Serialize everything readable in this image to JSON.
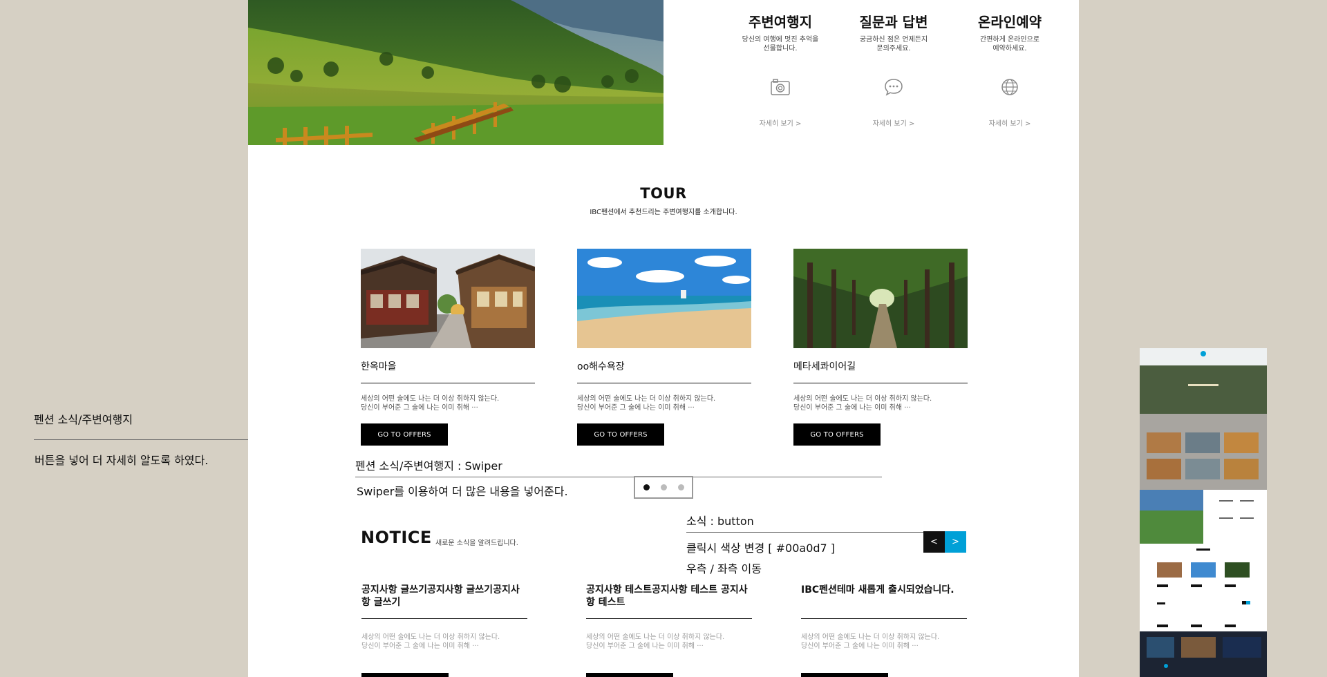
{
  "services": [
    {
      "title": "주변여행지",
      "desc_line1": "당신의 여행에 멋진 추억을",
      "desc_line2": "선물합니다.",
      "icon": "camera-icon",
      "more": "자세히 보기 >"
    },
    {
      "title": "질문과 답변",
      "desc_line1": "궁금하신 점은 언제든지",
      "desc_line2": "문의주세요.",
      "icon": "chat-bubble-icon",
      "more": "자세히 보기 >"
    },
    {
      "title": "온라인예약",
      "desc_line1": "간편하게 온라인으로",
      "desc_line2": "예약하세요.",
      "icon": "globe-icon",
      "more": "자세히 보기 >"
    }
  ],
  "tour": {
    "title": "TOUR",
    "subtitle": "IBC펜션에서 추천드리는 주변여행지를 소개합니다.",
    "cards": [
      {
        "name": "한옥마을",
        "line1": "세상의 어떤 술에도 나는 더 이상 취하지 않는다.",
        "line2": "당신이 부어준 그 술에 나는 이미 취해 ···",
        "button": "GO TO OFFERS"
      },
      {
        "name": "oo해수욕장",
        "line1": "세상의 어떤 술에도 나는 더 이상 취하지 않는다.",
        "line2": "당신이 부어준 그 술에 나는 이미 취해 ···",
        "button": "GO TO OFFERS"
      },
      {
        "name": "메타세콰이어길",
        "line1": "세상의 어떤 술에도 나는 더 이상 취하지 않는다.",
        "line2": "당신이 부어준 그 술에 나는 이미 취해 ···",
        "button": "GO TO OFFERS"
      }
    ]
  },
  "annotations": {
    "left_title": "펜션 소식/주변여행지",
    "left_desc": "버튼을 넣어 더 자세히 알도록 하였다.",
    "swiper_title": "펜션 소식/주변여행지 : Swiper",
    "swiper_desc": "Swiper를 이용하여 더 많은 내용을 넣어준다.",
    "button_title": "소식 : button",
    "button_desc1": "클릭시 색상 변경 [ #00a0d7 ]",
    "button_desc2": "우측 / 좌측 이동"
  },
  "pagination": {
    "count": 3,
    "active": 1
  },
  "notice": {
    "title": "NOTICE",
    "subtitle": "새로운 소식을 알려드립니다.",
    "prev": "<",
    "next": ">",
    "accent_color": "#00a0d7",
    "items": [
      {
        "title": "공지사항 글쓰기공지사항 글쓰기공지사항 글쓰기",
        "line1": "세상의 어떤 술에도 나는 더 이상 취하지 않는다.",
        "line2": "당신이 부어준 그 술에 나는 이미 취해 ···"
      },
      {
        "title": "공지사항 테스트공지사항 테스트 공지사항 테스트",
        "line1": "세상의 어떤 술에도 나는 더 이상 취하지 않는다.",
        "line2": "당신이 부어준 그 술에 나는 이미 취해 ···"
      },
      {
        "title": "IBC펜션테마 새롭게 출시되었습니다.",
        "line1": "세상의 어떤 술에도 나는 더 이상 취하지 않는다.",
        "line2": "당신이 부어준 그 술에 나는 이미 취해 ···"
      }
    ]
  },
  "mini_preview": {
    "label_tour": "TOUR",
    "label_notice": "NOTICE"
  }
}
